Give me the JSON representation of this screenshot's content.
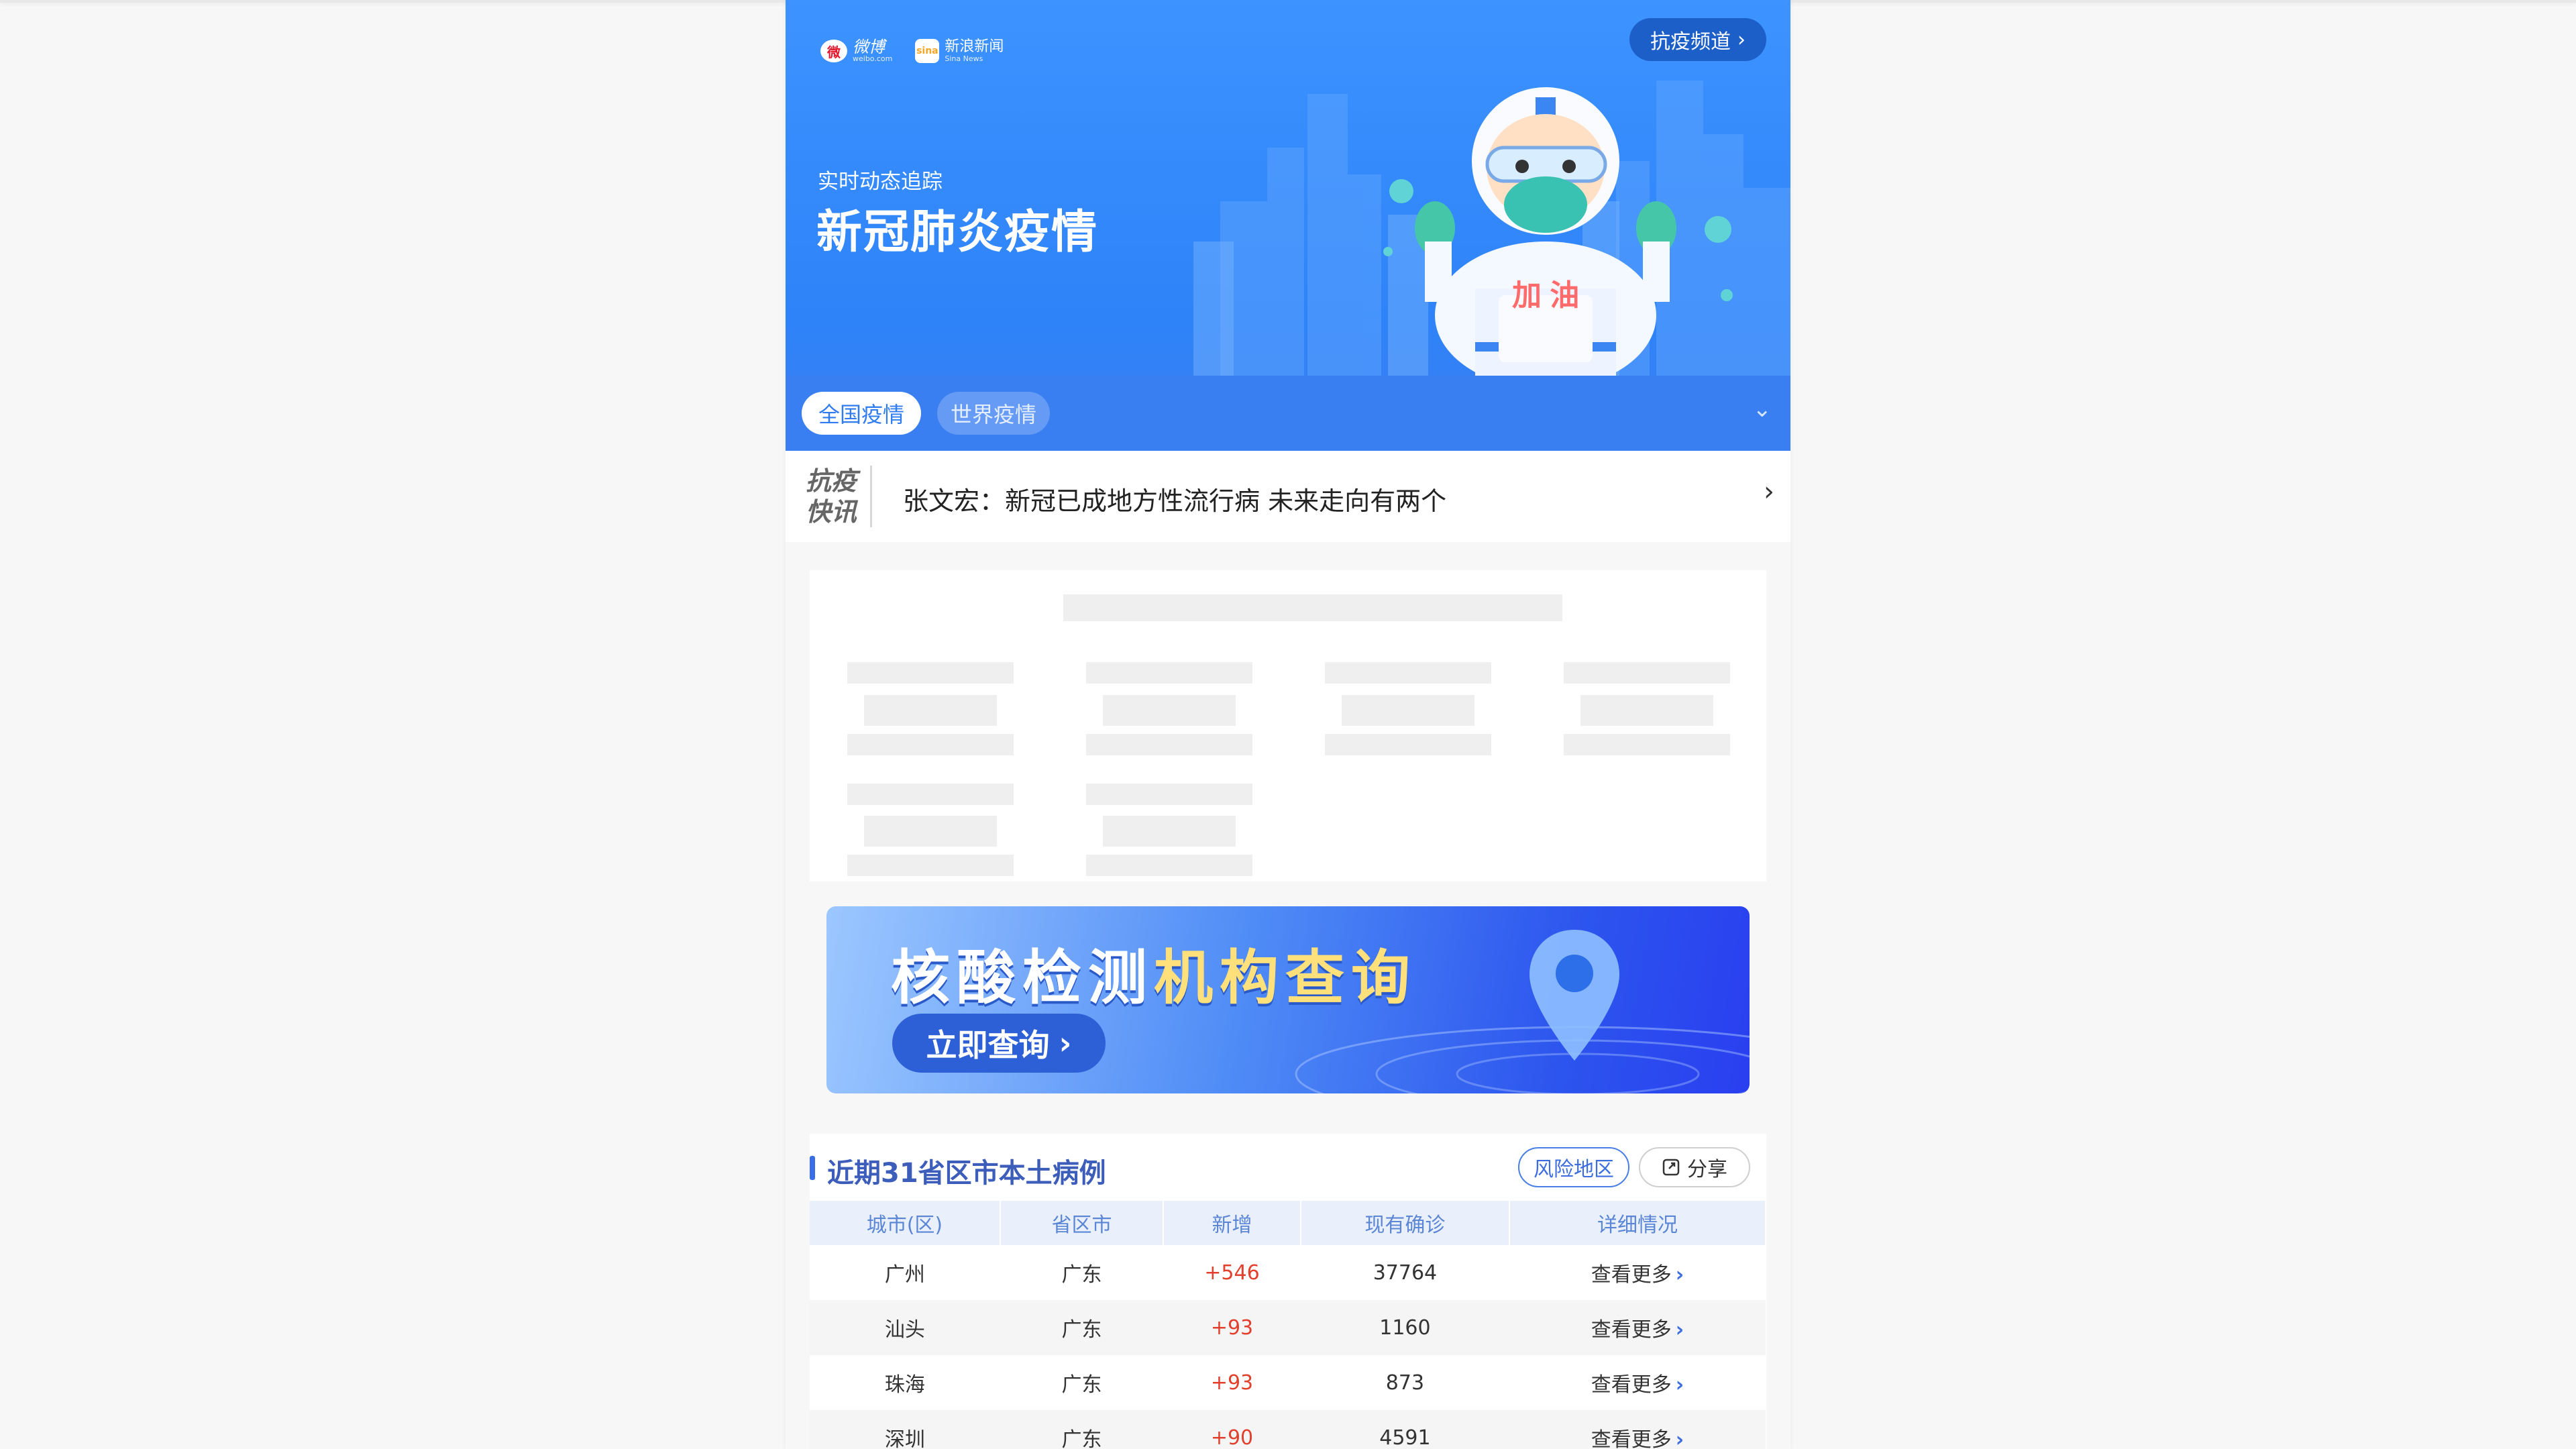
{
  "banner": {
    "logos": [
      {
        "mark": "微",
        "name": "微博",
        "sub": "weibo.com"
      },
      {
        "mark": "sina",
        "name": "新浪新闻",
        "sub": "Sina News"
      }
    ],
    "channel_button": "抗疫频道",
    "subtitle": "实时动态追踪",
    "title": "新冠肺炎疫情",
    "mascot_label": "加 油",
    "tabs": [
      "全国疫情",
      "世界疫情"
    ]
  },
  "ticker": {
    "tag_line1": "抗疫",
    "tag_line2": "快讯",
    "headline": "张文宏：新冠已成地方性流行病 未来走向有两个"
  },
  "nucleic_banner": {
    "title_part1": "核酸检测",
    "title_part2": "机构查询",
    "button": "立即查询"
  },
  "cases": {
    "title": "近期31省区市本土病例",
    "risk_button": "风险地区",
    "share_button": "分享",
    "columns": [
      "城市(区)",
      "省区市",
      "新增",
      "现有确诊",
      "详细情况"
    ],
    "rows": [
      {
        "city": "广州",
        "province": "广东",
        "new": "+546",
        "current": "37764",
        "detail": "查看更多"
      },
      {
        "city": "汕头",
        "province": "广东",
        "new": "+93",
        "current": "1160",
        "detail": "查看更多"
      },
      {
        "city": "珠海",
        "province": "广东",
        "new": "+93",
        "current": "873",
        "detail": "查看更多"
      },
      {
        "city": "深圳",
        "province": "广东",
        "new": "+90",
        "current": "4591",
        "detail": "查看更多"
      }
    ]
  },
  "colors": {
    "accent_blue": "#2f7bf2",
    "new_case_red": "#e2402d",
    "header_text_blue": "#5b86d6"
  },
  "icons": [
    "weibo-logo",
    "sina-news-logo",
    "chevron-right-icon",
    "chevron-down-icon",
    "share-icon",
    "location-pin-icon"
  ]
}
